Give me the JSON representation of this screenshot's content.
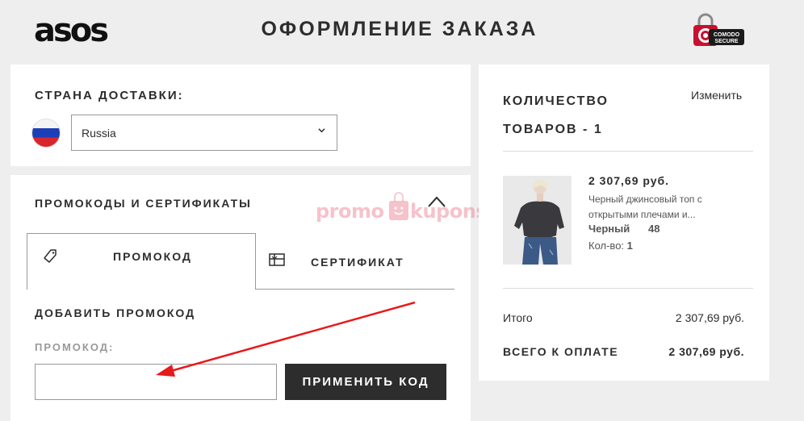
{
  "header": {
    "logo": "asos",
    "title": "ОФОРМЛЕНИЕ ЗАКАЗА",
    "secure_badge": {
      "line1": "COMODO",
      "line2": "SECURE"
    }
  },
  "delivery": {
    "title": "СТРАНА ДОСТАВКИ:",
    "country": "Russia",
    "flag": "russia-flag-icon"
  },
  "promo": {
    "title": "ПРОМОКОДЫ И СЕРТИФИКАТЫ",
    "tabs": [
      {
        "label": "ПРОМОКОД",
        "icon": "tag-icon",
        "active": true
      },
      {
        "label": "СЕРТИФИКАТ",
        "icon": "gift-card-icon",
        "active": false
      }
    ],
    "add_title": "ДОБАВИТЬ ПРОМОКОД",
    "field_label": "ПРОМОКОД:",
    "input_value": "",
    "apply_button": "ПРИМЕНИТЬ КОД"
  },
  "watermark": {
    "left": "promo",
    "right": "kupons"
  },
  "summary": {
    "title": "КОЛИЧЕСТВО ТОВАРОВ - 1",
    "edit": "Изменить",
    "item": {
      "price": "2 307,69 руб.",
      "description": "Черный джинсовый топ с открытыми плечами и...",
      "color": "Черный",
      "size": "48",
      "qty_label": "Кол-во:",
      "qty": "1"
    },
    "subtotal_label": "Итого",
    "subtotal_value": "2 307,69 руб.",
    "total_label": "ВСЕГО К ОПЛАТЕ",
    "total_value": "2 307,69 руб."
  },
  "colors": {
    "accent": "#2d2d2d",
    "annotation_arrow": "#e8191a",
    "watermark": "#ec788c"
  }
}
